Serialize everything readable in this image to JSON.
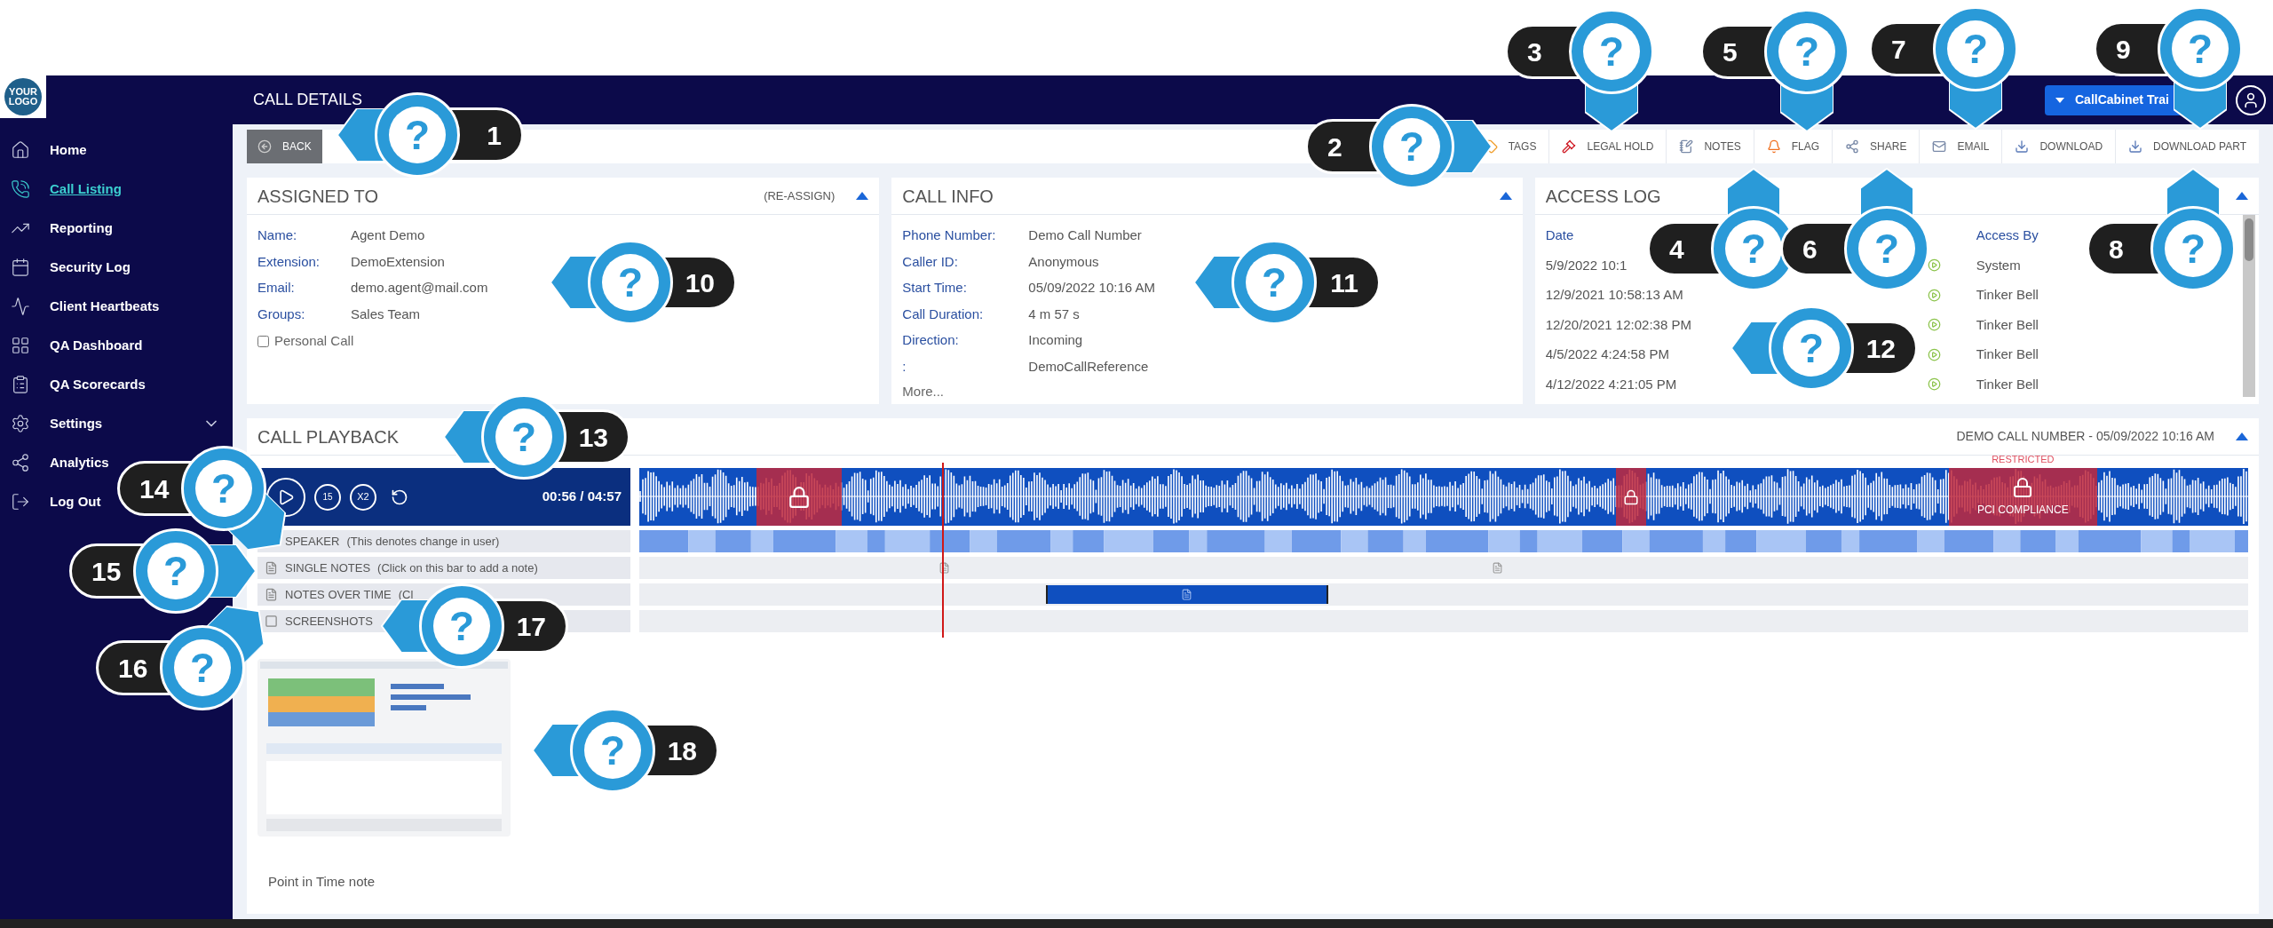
{
  "sidebar": {
    "logo": [
      "YOUR",
      "LOGO"
    ],
    "items": [
      {
        "label": "Home",
        "selected": false,
        "kind": "home"
      },
      {
        "label": "Call Listing",
        "selected": true,
        "kind": "calls"
      },
      {
        "label": "Reporting",
        "selected": false,
        "kind": "reporting"
      },
      {
        "label": "Security Log",
        "selected": false,
        "kind": "security"
      },
      {
        "label": "Client Heartbeats",
        "selected": false,
        "kind": "heartbeat"
      },
      {
        "label": "QA Dashboard",
        "selected": false,
        "kind": "dashboard"
      },
      {
        "label": "QA Scorecards",
        "selected": false,
        "kind": "scorecards"
      },
      {
        "label": "Settings",
        "selected": false,
        "kind": "settings",
        "expandable": true
      },
      {
        "label": "Analytics",
        "selected": false,
        "kind": "analytics"
      },
      {
        "label": "Log Out",
        "selected": false,
        "kind": "logout"
      }
    ]
  },
  "header": {
    "title": "CALL DETAILS",
    "account": "CallCabinet Trai"
  },
  "toolbar": {
    "back": "BACK",
    "actions": [
      {
        "label": "TAGS",
        "kind": "tag"
      },
      {
        "label": "LEGAL HOLD",
        "kind": "gavel"
      },
      {
        "label": "NOTES",
        "kind": "notes"
      },
      {
        "label": "FLAG",
        "kind": "bell"
      },
      {
        "label": "SHARE",
        "kind": "share"
      },
      {
        "label": "EMAIL",
        "kind": "mail"
      },
      {
        "label": "DOWNLOAD",
        "kind": "download"
      },
      {
        "label": "DOWNLOAD PART",
        "kind": "download"
      }
    ]
  },
  "assigned_to": {
    "title": "ASSIGNED TO",
    "action": "(RE-ASSIGN)",
    "fields": [
      {
        "label": "Name:",
        "value": "Agent Demo"
      },
      {
        "label": "Extension:",
        "value": "DemoExtension"
      },
      {
        "label": "Email:",
        "value": "demo.agent@mail.com"
      },
      {
        "label": "Groups:",
        "value": "Sales Team"
      }
    ],
    "personal_call": {
      "label": "Personal Call",
      "checked": false
    }
  },
  "call_info": {
    "title": "CALL INFO",
    "fields": [
      {
        "label": "Phone Number:",
        "value": "Demo Call Number"
      },
      {
        "label": "Caller ID:",
        "value": "Anonymous"
      },
      {
        "label": "Start Time:",
        "value": "05/09/2022 10:16 AM"
      },
      {
        "label": "Call Duration:",
        "value": "4 m 57 s"
      },
      {
        "label": "Direction:",
        "value": "Incoming"
      },
      {
        "label": ":",
        "value": "DemoCallReference"
      }
    ],
    "more": "More..."
  },
  "access_log": {
    "title": "ACCESS LOG",
    "columns": [
      "Date",
      "Access By"
    ],
    "rows": [
      {
        "date": "5/9/2022 10:1",
        "by": "System"
      },
      {
        "date": "12/9/2021 10:58:13 AM",
        "by": "Tinker Bell"
      },
      {
        "date": "12/20/2021 12:02:38 PM",
        "by": "Tinker Bell"
      },
      {
        "date": "4/5/2022 4:24:58 PM",
        "by": "Tinker Bell"
      },
      {
        "date": "4/12/2022 4:21:05 PM",
        "by": "Tinker Bell"
      }
    ]
  },
  "playback": {
    "title": "CALL PLAYBACK",
    "subtitle": "DEMO CALL NUMBER - 05/09/2022 10:16 AM",
    "skip": "15",
    "speed": "X2",
    "time": "00:56 / 04:57",
    "restricted_label": "RESTRICTED",
    "compliance_label": "PCI COMPLIANCE",
    "tracks": [
      {
        "kind": "speaker",
        "label": "SPEAKER",
        "hint": "(This denotes change in user)"
      },
      {
        "kind": "single_notes",
        "label": "SINGLE NOTES",
        "hint": "(Click on this bar to add a note)"
      },
      {
        "kind": "notes_over_time",
        "label": "NOTES OVER TIME",
        "hint": "(Cl"
      },
      {
        "kind": "screenshots",
        "label": "SCREENSHOTS"
      }
    ],
    "note": "Point in Time note"
  },
  "callouts": [
    {
      "number": "1",
      "symbol": "?"
    },
    {
      "number": "2",
      "symbol": "?"
    },
    {
      "number": "3",
      "symbol": "?"
    },
    {
      "number": "4",
      "symbol": "?"
    },
    {
      "number": "5",
      "symbol": "?"
    },
    {
      "number": "6",
      "symbol": "?"
    },
    {
      "number": "7",
      "symbol": "?"
    },
    {
      "number": "8",
      "symbol": "?"
    },
    {
      "number": "9",
      "symbol": "?"
    },
    {
      "number": "10",
      "symbol": "?"
    },
    {
      "number": "11",
      "symbol": "?"
    },
    {
      "number": "12",
      "symbol": "?"
    },
    {
      "number": "13",
      "symbol": "?"
    },
    {
      "number": "14",
      "symbol": "?"
    },
    {
      "number": "15",
      "symbol": "?"
    },
    {
      "number": "16",
      "symbol": "?"
    },
    {
      "number": "17",
      "symbol": "?"
    },
    {
      "number": "18",
      "symbol": "?"
    }
  ]
}
